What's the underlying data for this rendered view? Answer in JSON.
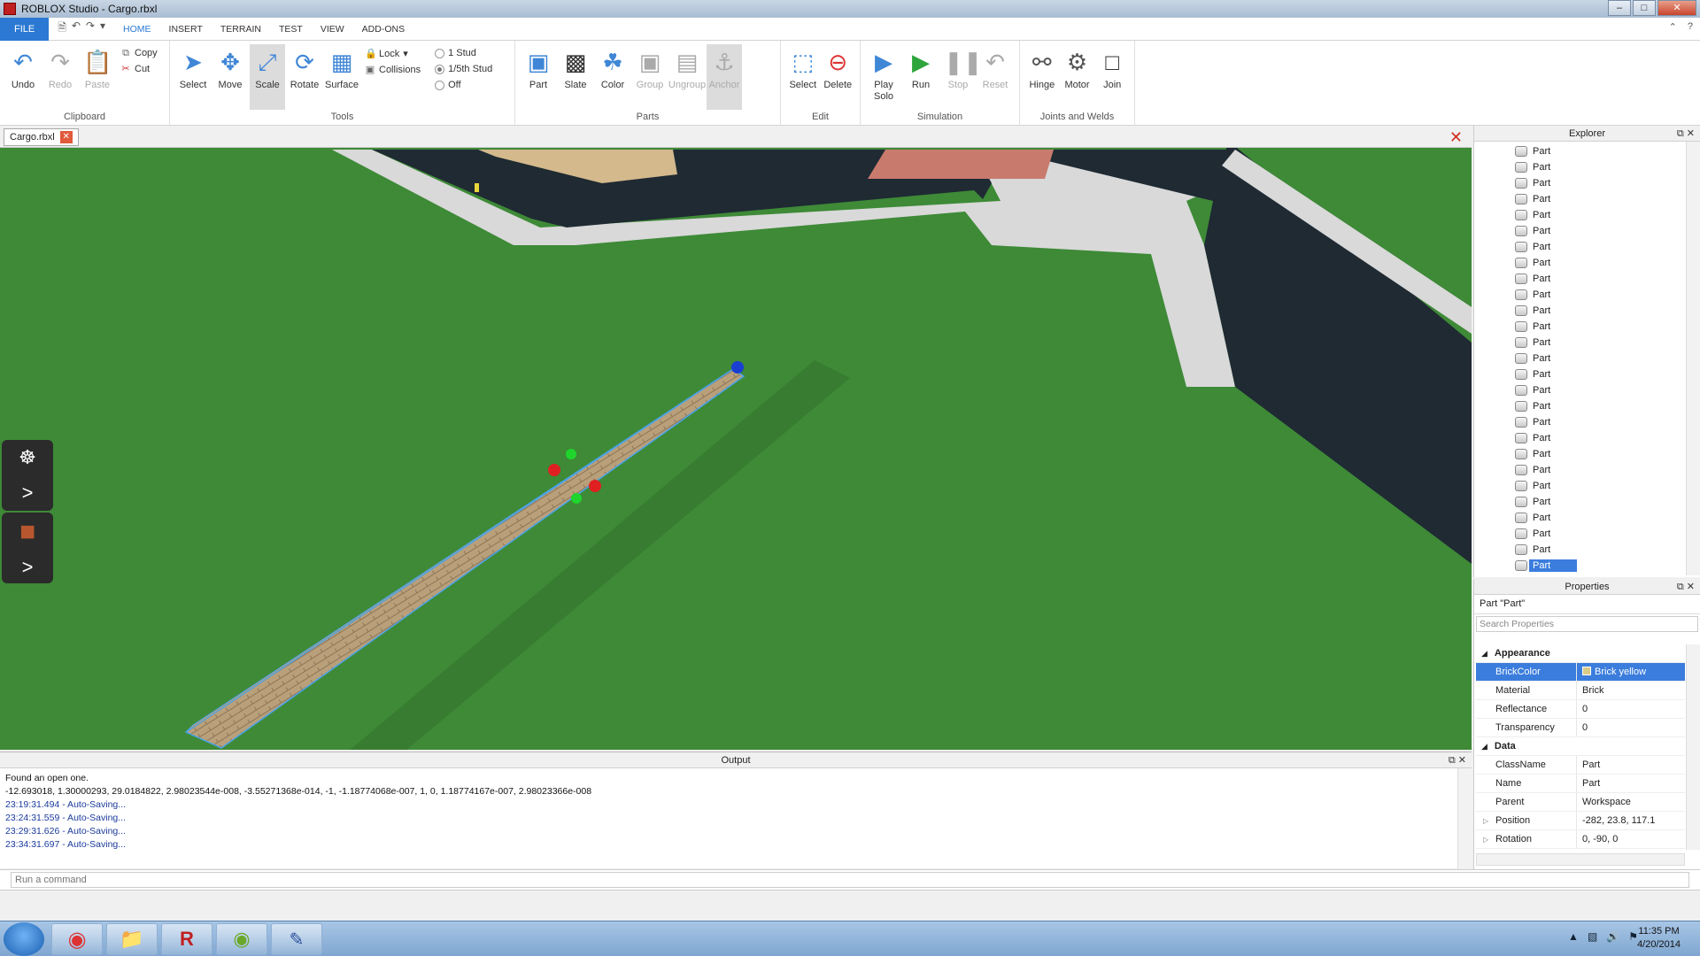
{
  "window": {
    "title": "ROBLOX Studio - Cargo.rbxl"
  },
  "menu": {
    "file": "FILE",
    "tabs": [
      "HOME",
      "INSERT",
      "TERRAIN",
      "TEST",
      "VIEW",
      "ADD-ONS"
    ]
  },
  "ribbon": {
    "clipboard": {
      "label": "Clipboard",
      "undo": "Undo",
      "redo": "Redo",
      "paste": "Paste",
      "copy": "Copy",
      "cut": "Cut"
    },
    "tools": {
      "label": "Tools",
      "select": "Select",
      "move": "Move",
      "scale": "Scale",
      "rotate": "Rotate",
      "surface": "Surface",
      "lock": "Lock",
      "collisions": "Collisions",
      "stud1": "1 Stud",
      "stud5": "1/5th Stud",
      "off": "Off"
    },
    "parts": {
      "label": "Parts",
      "part": "Part",
      "slate": "Slate",
      "color": "Color",
      "group": "Group",
      "ungroup": "Ungroup",
      "anchor": "Anchor"
    },
    "edit": {
      "label": "Edit",
      "select": "Select",
      "delete": "Delete"
    },
    "simulation": {
      "label": "Simulation",
      "play_solo": "Play\nSolo",
      "run": "Run",
      "stop": "Stop",
      "reset": "Reset"
    },
    "joints": {
      "label": "Joints and Welds",
      "hinge": "Hinge",
      "motor": "Motor",
      "join": "Join"
    }
  },
  "doc_tab": {
    "name": "Cargo.rbxl"
  },
  "output": {
    "title": "Output",
    "lines": [
      {
        "text": "Found an open one.",
        "color": "black"
      },
      {
        "text": "-12.693018, 1.30000293, 29.0184822, 2.98023544e-008, -3.55271368e-014, -1, -1.18774068e-007, 1, 0, 1.18774167e-007, 2.98023366e-008",
        "color": "black"
      },
      {
        "text": "23:19:31.494 - Auto-Saving...",
        "color": "blue"
      },
      {
        "text": "23:24:31.559 - Auto-Saving...",
        "color": "blue"
      },
      {
        "text": "23:29:31.626 - Auto-Saving...",
        "color": "blue"
      },
      {
        "text": "23:34:31.697 - Auto-Saving...",
        "color": "blue"
      }
    ]
  },
  "command": {
    "placeholder": "Run a command"
  },
  "explorer": {
    "title": "Explorer",
    "items": [
      "Part",
      "Part",
      "Part",
      "Part",
      "Part",
      "Part",
      "Part",
      "Part",
      "Part",
      "Part",
      "Part",
      "Part",
      "Part",
      "Part",
      "Part",
      "Part",
      "Part",
      "Part",
      "Part",
      "Part",
      "Part",
      "Part",
      "Part",
      "Part",
      "Part",
      "Part"
    ],
    "selected_index": 26,
    "selected_label": "Part"
  },
  "properties": {
    "title": "Properties",
    "object": "Part \"Part\"",
    "search_placeholder": "Search Properties",
    "sections": [
      {
        "name": "Appearance",
        "rows": [
          {
            "name": "BrickColor",
            "value": "Brick yellow",
            "selected": true
          },
          {
            "name": "Material",
            "value": "Brick"
          },
          {
            "name": "Reflectance",
            "value": "0"
          },
          {
            "name": "Transparency",
            "value": "0"
          }
        ]
      },
      {
        "name": "Data",
        "rows": [
          {
            "name": "ClassName",
            "value": "Part"
          },
          {
            "name": "Name",
            "value": "Part"
          },
          {
            "name": "Parent",
            "value": "Workspace"
          },
          {
            "name": "Position",
            "value": "-282, 23.8, 117.1",
            "expandable": true
          },
          {
            "name": "Rotation",
            "value": "0, -90, 0",
            "expandable": true
          }
        ]
      }
    ]
  },
  "taskbar": {
    "time": "11:35 PM",
    "date": "4/20/2014",
    "apps": [
      "chrome-icon",
      "folder-icon",
      "roblox-icon",
      "spotify-icon",
      "roblox-studio-icon"
    ]
  },
  "colors": {
    "accent": "#2b79d3",
    "grass": "#3e8a37",
    "road": "#1f2a33",
    "sidewalk": "#d8d8d8",
    "selection": "#3b7ddd"
  }
}
